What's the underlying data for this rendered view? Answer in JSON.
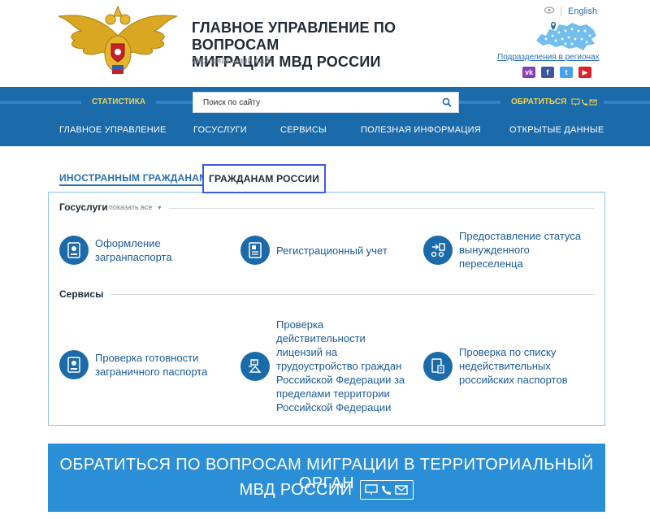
{
  "header": {
    "title_line1": "ГЛАВНОЕ УПРАВЛЕНИЕ ПО ВОПРОСАМ",
    "title_line2": "МИГРАЦИИ МВД РОССИИ",
    "subtitle": "Официальный сайт",
    "language_link": "English",
    "regions_link": "Подразделения в регионах",
    "socials": [
      {
        "name": "vk-icon",
        "glyph": "vk",
        "color": "#8a3fb5"
      },
      {
        "name": "facebook-icon",
        "glyph": "f",
        "color": "#3b5998"
      },
      {
        "name": "twitter-icon",
        "glyph": "t",
        "color": "#4aa1eb"
      },
      {
        "name": "youtube-icon",
        "glyph": "▶",
        "color": "#d9232e"
      }
    ]
  },
  "nav": {
    "statistics": "СТАТИСТИКА",
    "search_placeholder": "Поиск по сайту",
    "contact": "ОБРАТИТЬСЯ",
    "menu": [
      "ГЛАВНОЕ УПРАВЛЕНИЕ",
      "ГОСУСЛУГИ",
      "СЕРВИСЫ",
      "ПОЛЕЗНАЯ ИНФОРМАЦИЯ",
      "ОТКРЫТЫЕ ДАННЫЕ"
    ]
  },
  "tabs": {
    "foreign": "ИНОСТРАННЫМ ГРАЖДАНАМ",
    "russian": "ГРАЖДАНАМ РОССИИ"
  },
  "gosuslugi": {
    "title": "Госуслуги",
    "show_all": "показать все",
    "items": [
      {
        "label": "Оформление загранпаспорта"
      },
      {
        "label": "Регистрационный учет"
      },
      {
        "label": "Предоставление статуса вынужденного переселенца"
      }
    ]
  },
  "services": {
    "title": "Сервисы",
    "items": [
      {
        "label": "Проверка готовности заграничного паспорта"
      },
      {
        "label": "Проверка действительности лицензий на трудоустройство граждан Российской Федерации за пределами территории Российской Федерации"
      },
      {
        "label": "Проверка по списку недействительных российских паспортов"
      }
    ]
  },
  "banner": {
    "line1": "ОБРАТИТЬСЯ ПО ВОПРОСАМ МИГРАЦИИ В ТЕРРИТОРИАЛЬНЫЙ ОРГАН",
    "line2": "МВД РОССИИ"
  },
  "colors": {
    "nav_blue": "#1b6aaa",
    "accent_yellow": "#f2d34b",
    "link_blue": "#2a6fb0",
    "banner_blue": "#2b8fd8"
  }
}
